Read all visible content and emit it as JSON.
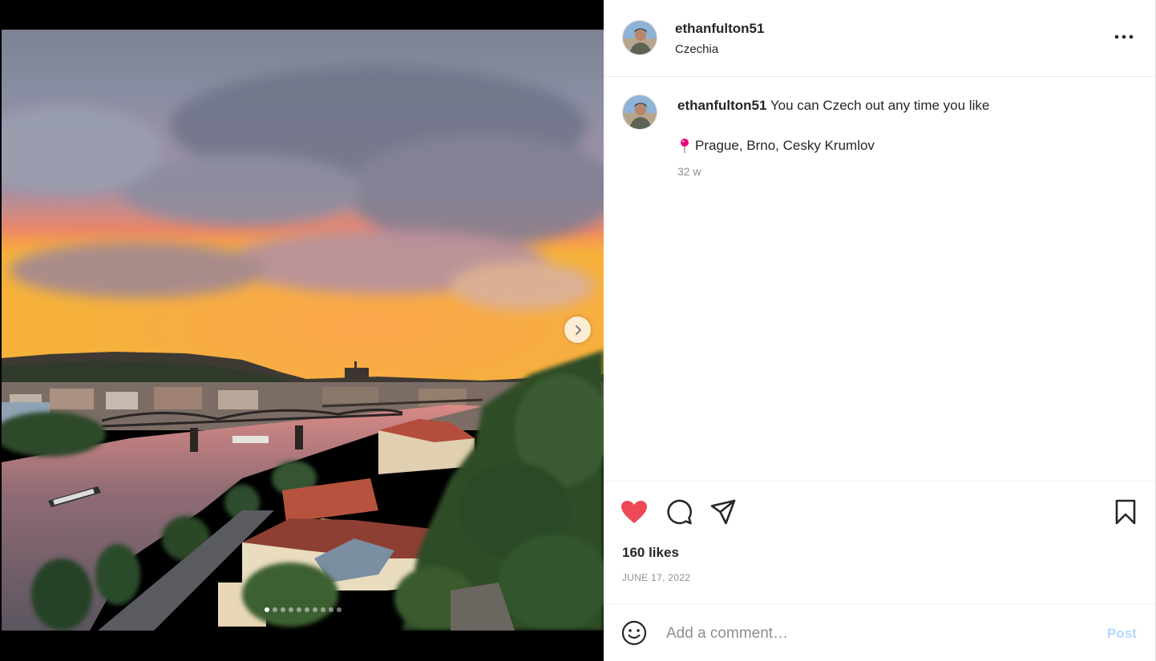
{
  "post": {
    "username": "ethanfulton51",
    "location": "Czechia",
    "caption_user": "ethanfulton51",
    "caption_text": "You can Czech out any time you like",
    "caption_places": "Prague, Brno, Cesky Krumlov",
    "time_ago": "32 w",
    "likes": "160 likes",
    "date": "JUNE 17, 2022",
    "liked": true
  },
  "carousel": {
    "total_slides": 10,
    "current_slide": 1
  },
  "comment": {
    "placeholder": "Add a comment…",
    "post_label": "Post"
  },
  "icons": {
    "more": "more-options-icon",
    "next": "chevron-right-icon",
    "pin": "round-pushpin-icon",
    "like": "heart-filled-icon",
    "comment": "comment-bubble-icon",
    "share": "paper-plane-icon",
    "save": "bookmark-icon",
    "emoji": "smiley-face-icon"
  },
  "colors": {
    "like": "#ed4956",
    "post_button": "#b3dbff",
    "pin": "#e6007e",
    "secondary_text": "#8e8e8e"
  }
}
